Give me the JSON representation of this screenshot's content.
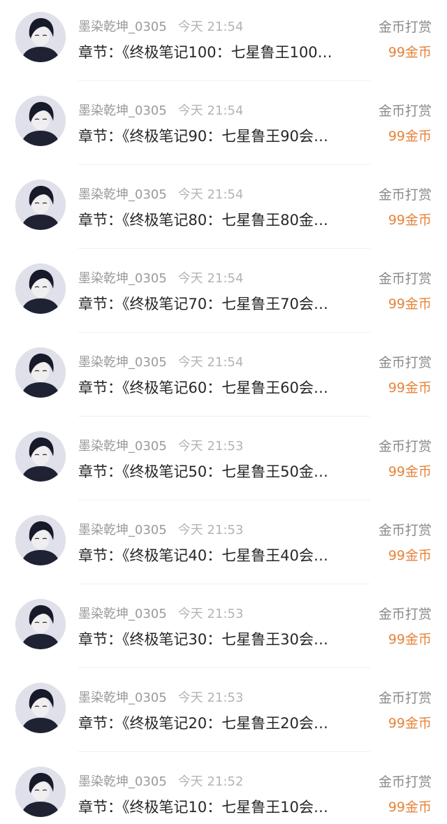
{
  "records": [
    {
      "user": "墨染乾坤_0305",
      "time": "今天 21:54",
      "chapter": "章节：《终极笔记100：七星鲁王100…",
      "type": "金币打赏",
      "amount": "99金币"
    },
    {
      "user": "墨染乾坤_0305",
      "time": "今天 21:54",
      "chapter": "章节：《终极笔记90：七星鲁王90会…",
      "type": "金币打赏",
      "amount": "99金币"
    },
    {
      "user": "墨染乾坤_0305",
      "time": "今天 21:54",
      "chapter": "章节：《终极笔记80：七星鲁王80金…",
      "type": "金币打赏",
      "amount": "99金币"
    },
    {
      "user": "墨染乾坤_0305",
      "time": "今天 21:54",
      "chapter": "章节：《终极笔记70：七星鲁王70会…",
      "type": "金币打赏",
      "amount": "99金币"
    },
    {
      "user": "墨染乾坤_0305",
      "time": "今天 21:54",
      "chapter": "章节：《终极笔记60：七星鲁王60会…",
      "type": "金币打赏",
      "amount": "99金币"
    },
    {
      "user": "墨染乾坤_0305",
      "time": "今天 21:53",
      "chapter": "章节：《终极笔记50：七星鲁王50金…",
      "type": "金币打赏",
      "amount": "99金币"
    },
    {
      "user": "墨染乾坤_0305",
      "time": "今天 21:53",
      "chapter": "章节：《终极笔记40：七星鲁王40会…",
      "type": "金币打赏",
      "amount": "99金币"
    },
    {
      "user": "墨染乾坤_0305",
      "time": "今天 21:53",
      "chapter": "章节：《终极笔记30：七星鲁王30会…",
      "type": "金币打赏",
      "amount": "99金币"
    },
    {
      "user": "墨染乾坤_0305",
      "time": "今天 21:53",
      "chapter": "章节：《终极笔记20：七星鲁王20会…",
      "type": "金币打赏",
      "amount": "99金币"
    },
    {
      "user": "墨染乾坤_0305",
      "time": "今天 21:52",
      "chapter": "章节：《终极笔记10：七星鲁王10会…",
      "type": "金币打赏",
      "amount": "99金币"
    }
  ],
  "colors": {
    "amount": "#e6833a",
    "username": "#9a9a9a",
    "title": "#262626",
    "type": "#8a8a8a"
  },
  "icons": {
    "avatar": "user-avatar-photo"
  }
}
